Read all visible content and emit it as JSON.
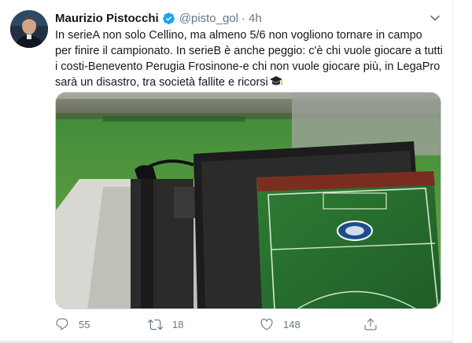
{
  "tweet": {
    "author_name": "Maurizio Pistocchi",
    "handle": "@pisto_gol",
    "separator": "·",
    "time": "4h",
    "text_lines": [
      "In serieA non solo Cellino, ma almeno 5/6 non vogliono tornare in campo",
      "per finire il campionato. In serieB è anche peggio: c'è chi vuole giocare a tutti",
      "i costi-Benevento Perugia Frosinone-e chi non vuole giocare più, in LegaPro",
      "sarà un disastro, tra società fallite e ricorsi"
    ],
    "emoji": "graduation-cap-icon",
    "media": {
      "description_icon": "tv-camera-over-football-pitch-photo"
    },
    "actions": {
      "reply_count": "55",
      "retweet_count": "18",
      "like_count": "148"
    }
  },
  "colors": {
    "text": "#14171a",
    "secondary": "#657786",
    "verified": "#1da1f2",
    "border": "#e6ecf0"
  }
}
